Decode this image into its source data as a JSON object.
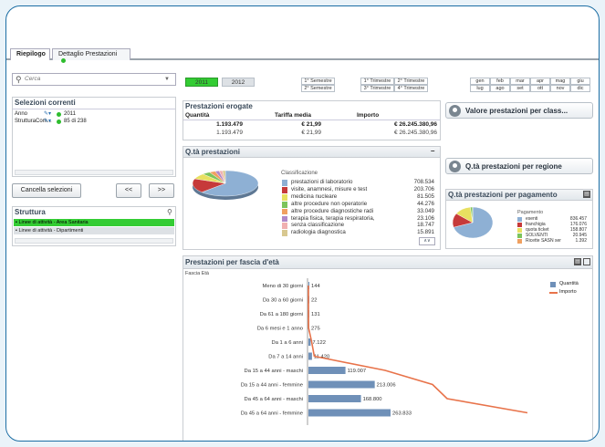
{
  "tabs": [
    {
      "label": "Riepilogo",
      "active": true
    },
    {
      "label": "Dettaglio Prestazioni",
      "active": false
    }
  ],
  "search": {
    "placeholder": "Cerca"
  },
  "years": [
    "2011",
    "2012"
  ],
  "semesters": [
    "1° Semestre",
    "2° Semestre"
  ],
  "quarters": [
    "1° Trimestre",
    "2° Trimestre",
    "3° Trimestre",
    "4° Trimestre"
  ],
  "months": [
    "gen",
    "feb",
    "mar",
    "apr",
    "mag",
    "giu",
    "lug",
    "ago",
    "set",
    "ott",
    "nov",
    "dic"
  ],
  "current_selections": {
    "title": "Selezioni correnti",
    "rows": [
      {
        "field": "Anno",
        "value": "2011"
      },
      {
        "field": "StrutturaCom...",
        "value": "85 di 238"
      }
    ],
    "clear_button": "Cancella selezioni",
    "back_button": "<<",
    "forward_button": ">>"
  },
  "struttura": {
    "title": "Struttura",
    "items": [
      "Linee di attività - Area Sanitaria",
      "Linee di attività - Dipartimenti"
    ]
  },
  "prestazioni_erogate": {
    "title": "Prestazioni erogate",
    "headers": [
      "Quantità",
      "Tariffa media",
      "Importo"
    ],
    "rows": [
      [
        "1.193.479",
        "€ 21,99",
        "€ 26.245.380,96"
      ],
      [
        "1.193.479",
        "€ 21,99",
        "€ 26.245.380,96"
      ]
    ]
  },
  "buttons": {
    "valore": "Valore prestazioni per class...",
    "regione": "Q.tà prestazioni per regione"
  },
  "qta_prestazioni": {
    "title": "Q.tà prestazioni",
    "legend_title": "Classificazione",
    "colors": [
      "#8eb0d4",
      "#c63a3a",
      "#e8e060",
      "#7cc45c",
      "#f0a060",
      "#b088c8",
      "#f0b0b0",
      "#d8c890",
      "#c0c0c0"
    ]
  },
  "pagamento": {
    "title": "Q.tà prestazioni per pagamento",
    "legend_title": "Pagamento",
    "colors": [
      "#8eb0d4",
      "#c63a3a",
      "#e8e060",
      "#7cc45c",
      "#f0a060"
    ]
  },
  "eta_chart": {
    "title": "Prestazioni per fascia d'età",
    "dimension_label": "Fascia Età",
    "legend": [
      "Quantità",
      "Importo"
    ]
  },
  "chart_data": [
    {
      "type": "pie",
      "title": "Q.tà prestazioni",
      "legend_title": "Classificazione",
      "categories": [
        "prestazioni di laboratorio",
        "visite, anamnesi, misure e test",
        "medicina nucleare",
        "altre procedure non operatorie",
        "altre procedure diagnostiche radi",
        "terapia fisica, terapia respiratoria,",
        "senza classificazione",
        "radiologia diagnostica"
      ],
      "values": [
        708534,
        203706,
        81505,
        44276,
        33049,
        23106,
        18747,
        15891
      ],
      "labels": [
        "708.534",
        "203.706",
        "81.505",
        "44.276",
        "33.049",
        "23.106",
        "18.747",
        "15.891"
      ]
    },
    {
      "type": "pie",
      "title": "Q.tà prestazioni per pagamento",
      "legend_title": "Pagamento",
      "categories": [
        "esenti",
        "franchigia",
        "quota ticket",
        "SOLVENTI",
        "Ricette SASN ser"
      ],
      "values": [
        836457,
        176076,
        158807,
        20945,
        1392
      ],
      "labels": [
        "836.457",
        "176.076",
        "158.807",
        "20.945",
        "1.392"
      ]
    },
    {
      "type": "bar",
      "title": "Prestazioni per fascia d'età",
      "categories": [
        "Meno di 30 giorni",
        "Da 30 a 60 giorni",
        "Da 61 a 180 giorni",
        "Da 6 mesi e 1 anno",
        "Da 1 a 6 anni",
        "Da 7 a 14 anni",
        "Da 15 a 44 anni - maschi",
        "Da 15 a 44 anni - femmine",
        "Da 45 a 64 anni - maschi",
        "Da 45 a 64 anni - femmine"
      ],
      "series": [
        {
          "name": "Quantità",
          "values": [
            144,
            22,
            131,
            275,
            7122,
            11420,
            119007,
            213006,
            168800,
            263833
          ],
          "labels": [
            "144",
            "22",
            "131",
            "275",
            "7.122",
            "11.420",
            "119.007",
            "213.006",
            "168.800",
            "263.833"
          ]
        },
        {
          "name": "Importo",
          "values": [
            1,
            0.5,
            2,
            5,
            90,
            160,
            2100,
            3400,
            3800,
            6000
          ]
        }
      ]
    }
  ]
}
